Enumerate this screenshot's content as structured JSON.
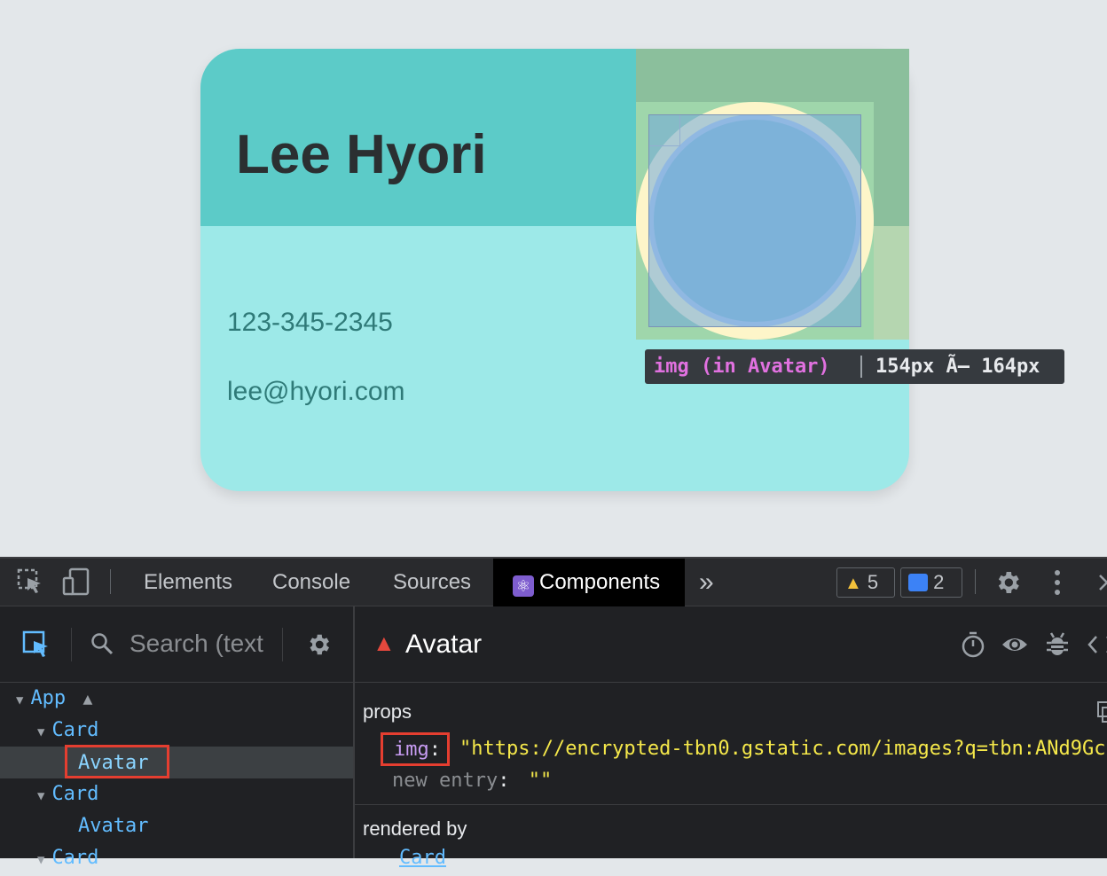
{
  "card": {
    "name": "Lee Hyori",
    "phone": "123-345-2345",
    "email": "lee@hyori.com"
  },
  "tooltip": {
    "element": "img (in Avatar)",
    "size": "154px Ã— 164px"
  },
  "devtools": {
    "tabs": [
      {
        "label": "Elements"
      },
      {
        "label": "Console"
      },
      {
        "label": "Sources"
      },
      {
        "label": "Components",
        "active": true
      }
    ],
    "more_tabs": "»",
    "warnings_count": "5",
    "messages_count": "2",
    "search_placeholder": "Search (text",
    "tree": [
      {
        "label": "App",
        "depth": 0,
        "warning": true
      },
      {
        "label": "Card",
        "depth": 1
      },
      {
        "label": "Avatar",
        "depth": 2,
        "selected": true
      },
      {
        "label": "Card",
        "depth": 1
      },
      {
        "label": "Avatar",
        "depth": 2
      },
      {
        "label": "Card",
        "depth": 1
      }
    ],
    "selected_component": "Avatar",
    "props_title": "props",
    "props": [
      {
        "key": "img",
        "value": "\"https://encrypted-tbn0.gstatic.com/images?q=tbn:ANd9Gc"
      }
    ],
    "new_entry_label": "new entry",
    "new_entry_value": "\"\"",
    "rendered_by_title": "rendered by",
    "rendered_by": [
      "Card"
    ]
  },
  "colors": {
    "card_top": "#5ccbc8",
    "card_body": "#9de9e8",
    "tree_text": "#62bcff",
    "string_value": "#f5e84a",
    "highlight": "#e53e30"
  }
}
